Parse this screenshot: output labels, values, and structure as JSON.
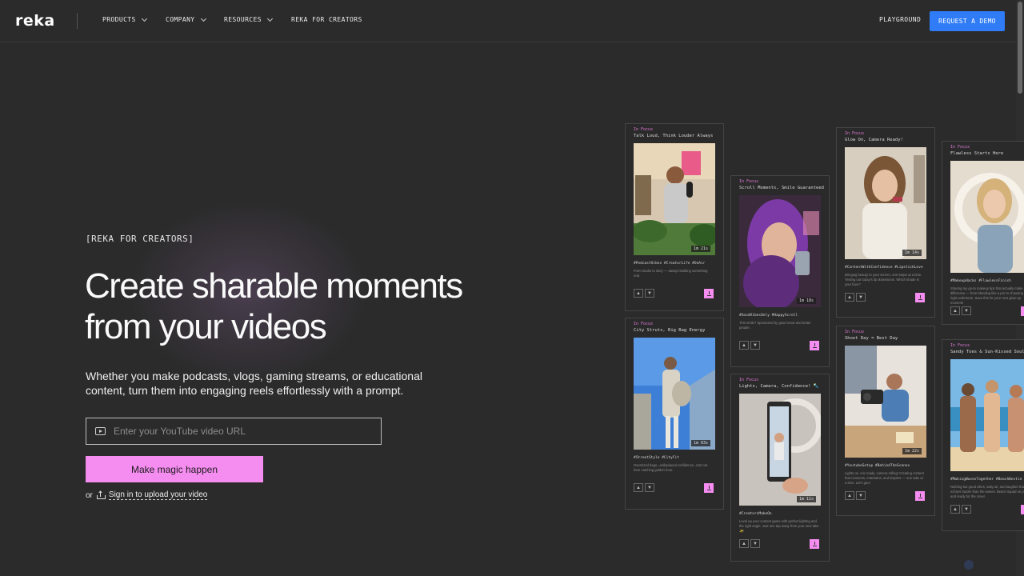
{
  "nav": {
    "logo": "reka",
    "items": [
      {
        "label": "PRODUCTS",
        "dropdown": true
      },
      {
        "label": "COMPANY",
        "dropdown": true
      },
      {
        "label": "RESOURCES",
        "dropdown": true
      },
      {
        "label": "REKA FOR CREATORS",
        "dropdown": false
      }
    ],
    "playground": "PLAYGROUND",
    "demo_button": "REQUEST A DEMO"
  },
  "hero": {
    "eyebrow": "[REKA FOR CREATORS]",
    "headline_line1": "Create sharable moments",
    "headline_line2": "from your videos",
    "subtitle": "Whether you make podcasts, vlogs, gaming streams, or educational content, turn them into engaging reels effortlessly with a prompt.",
    "url_placeholder": "Enter your YouTube video URL",
    "cta": "Make magic happen",
    "or": "or",
    "signin": "Sign in to upload your video"
  },
  "colors": {
    "accent_pink": "#f58cf0",
    "accent_blue": "#2f7cf6",
    "tag_pink": "#e27ad9"
  },
  "cards": [
    {
      "tag": "In Focus",
      "title": "Talk Loud, Think Louder Always",
      "duration": "1m 21s",
      "hashtags": "#PodcastVibes #CreatorLife #OnAir",
      "desc": "From studio to story — always building something real.",
      "thumb": "podcast"
    },
    {
      "tag": "In Focus",
      "title": "City Struts, Big Bag Energy",
      "duration": "1m 03s",
      "hashtags": "#StreetStyle #CityFit",
      "desc": "Oversized bags, undisplaced confidence. Just out here catching golden hour.",
      "thumb": "street"
    },
    {
      "tag": "In Focus",
      "title": "Scroll Moments, Smile Guaranteed",
      "duration": "1m 18s",
      "hashtags": "#GoodVibesOnly #HappyScroll",
      "desc": "This smile? Sponsored by good news and better people.",
      "thumb": "smile"
    },
    {
      "tag": "In Focus",
      "title": "Lights, Camera, Confidence! 🔦",
      "duration": "1m 11s",
      "hashtags": "#CreatorsMakeOn",
      "desc": "Level up your content game with perfect lighting and the right angle. Just one tap away from your next take ✨!",
      "thumb": "phone"
    },
    {
      "tag": "In Focus",
      "title": "Glow On, Camera Ready!",
      "duration": "1m 14s",
      "hashtags": "#ContentWithConfidence #LipstickLove",
      "desc": "Bringing beauty to your screen, one swipe at a time. Testing out today's lip obsessions. Which shade is your fave?",
      "thumb": "makeup"
    },
    {
      "tag": "In Focus",
      "title": "Shoot Day = Best Day",
      "duration": "1m 22s",
      "hashtags": "#YoutubeSetup #BehindTheScenes",
      "desc": "Lights on, mic ready, camera rolling! Creating content that connects, entertains, and inspires — one take at a time. Let's goo!",
      "thumb": "camera"
    },
    {
      "tag": "In Focus",
      "title": "Flawless Starts Here",
      "duration": "",
      "hashtags": "#MakeupHacks #FlawlessFinish",
      "desc": "Sharing my go-to makeup tips that actually make a difference — from blending like a pro to choosing the right undertone. Save this for your next glow-up moment!",
      "thumb": "mirror"
    },
    {
      "tag": "In Focus",
      "title": "Sandy Toes & Sun-Kissed Souls",
      "duration": "",
      "hashtags": "#MakingWavesTogether #BeachBestie",
      "desc": "Nothing but good vibes, salty air, and laughter that echoes louder than the waves. Beach squad on point and ready for the crew!",
      "thumb": "beach"
    }
  ]
}
